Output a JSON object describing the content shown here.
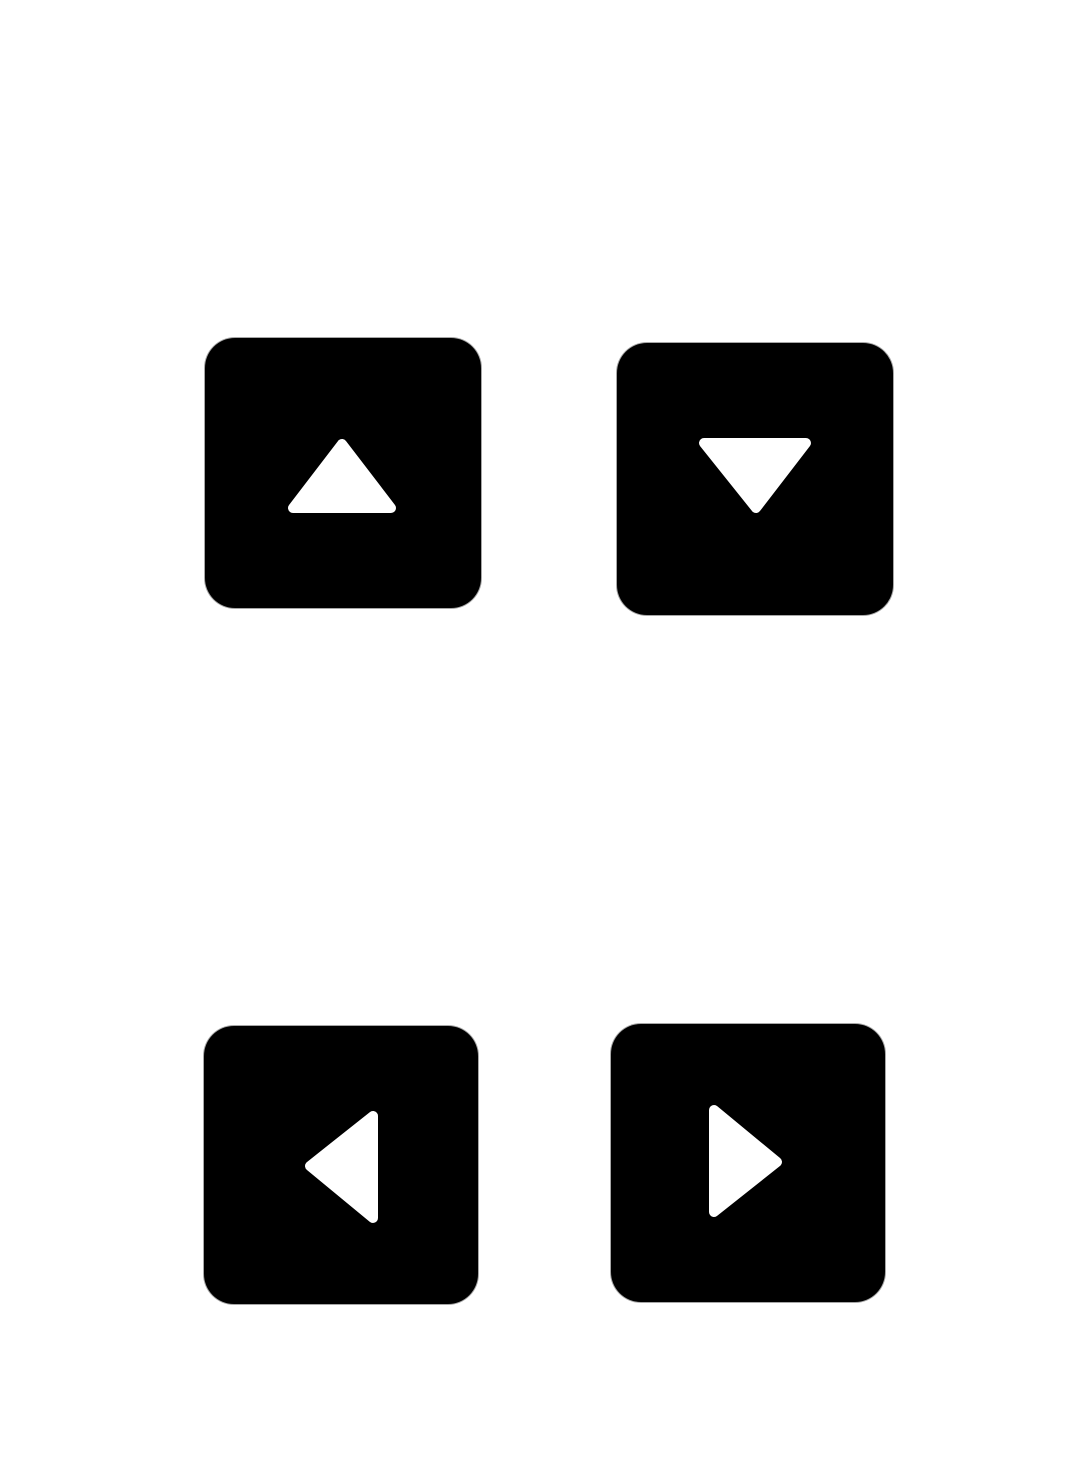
{
  "controls": {
    "buttons": [
      {
        "id": "up",
        "icon": "up-arrow-icon",
        "direction": "up"
      },
      {
        "id": "down",
        "icon": "down-arrow-icon",
        "direction": "down"
      },
      {
        "id": "left",
        "icon": "left-arrow-icon",
        "direction": "left"
      },
      {
        "id": "right",
        "icon": "right-arrow-icon",
        "direction": "right"
      }
    ]
  },
  "colors": {
    "background": "#ffffff",
    "button": "#000000",
    "glyph": "#ffffff"
  }
}
